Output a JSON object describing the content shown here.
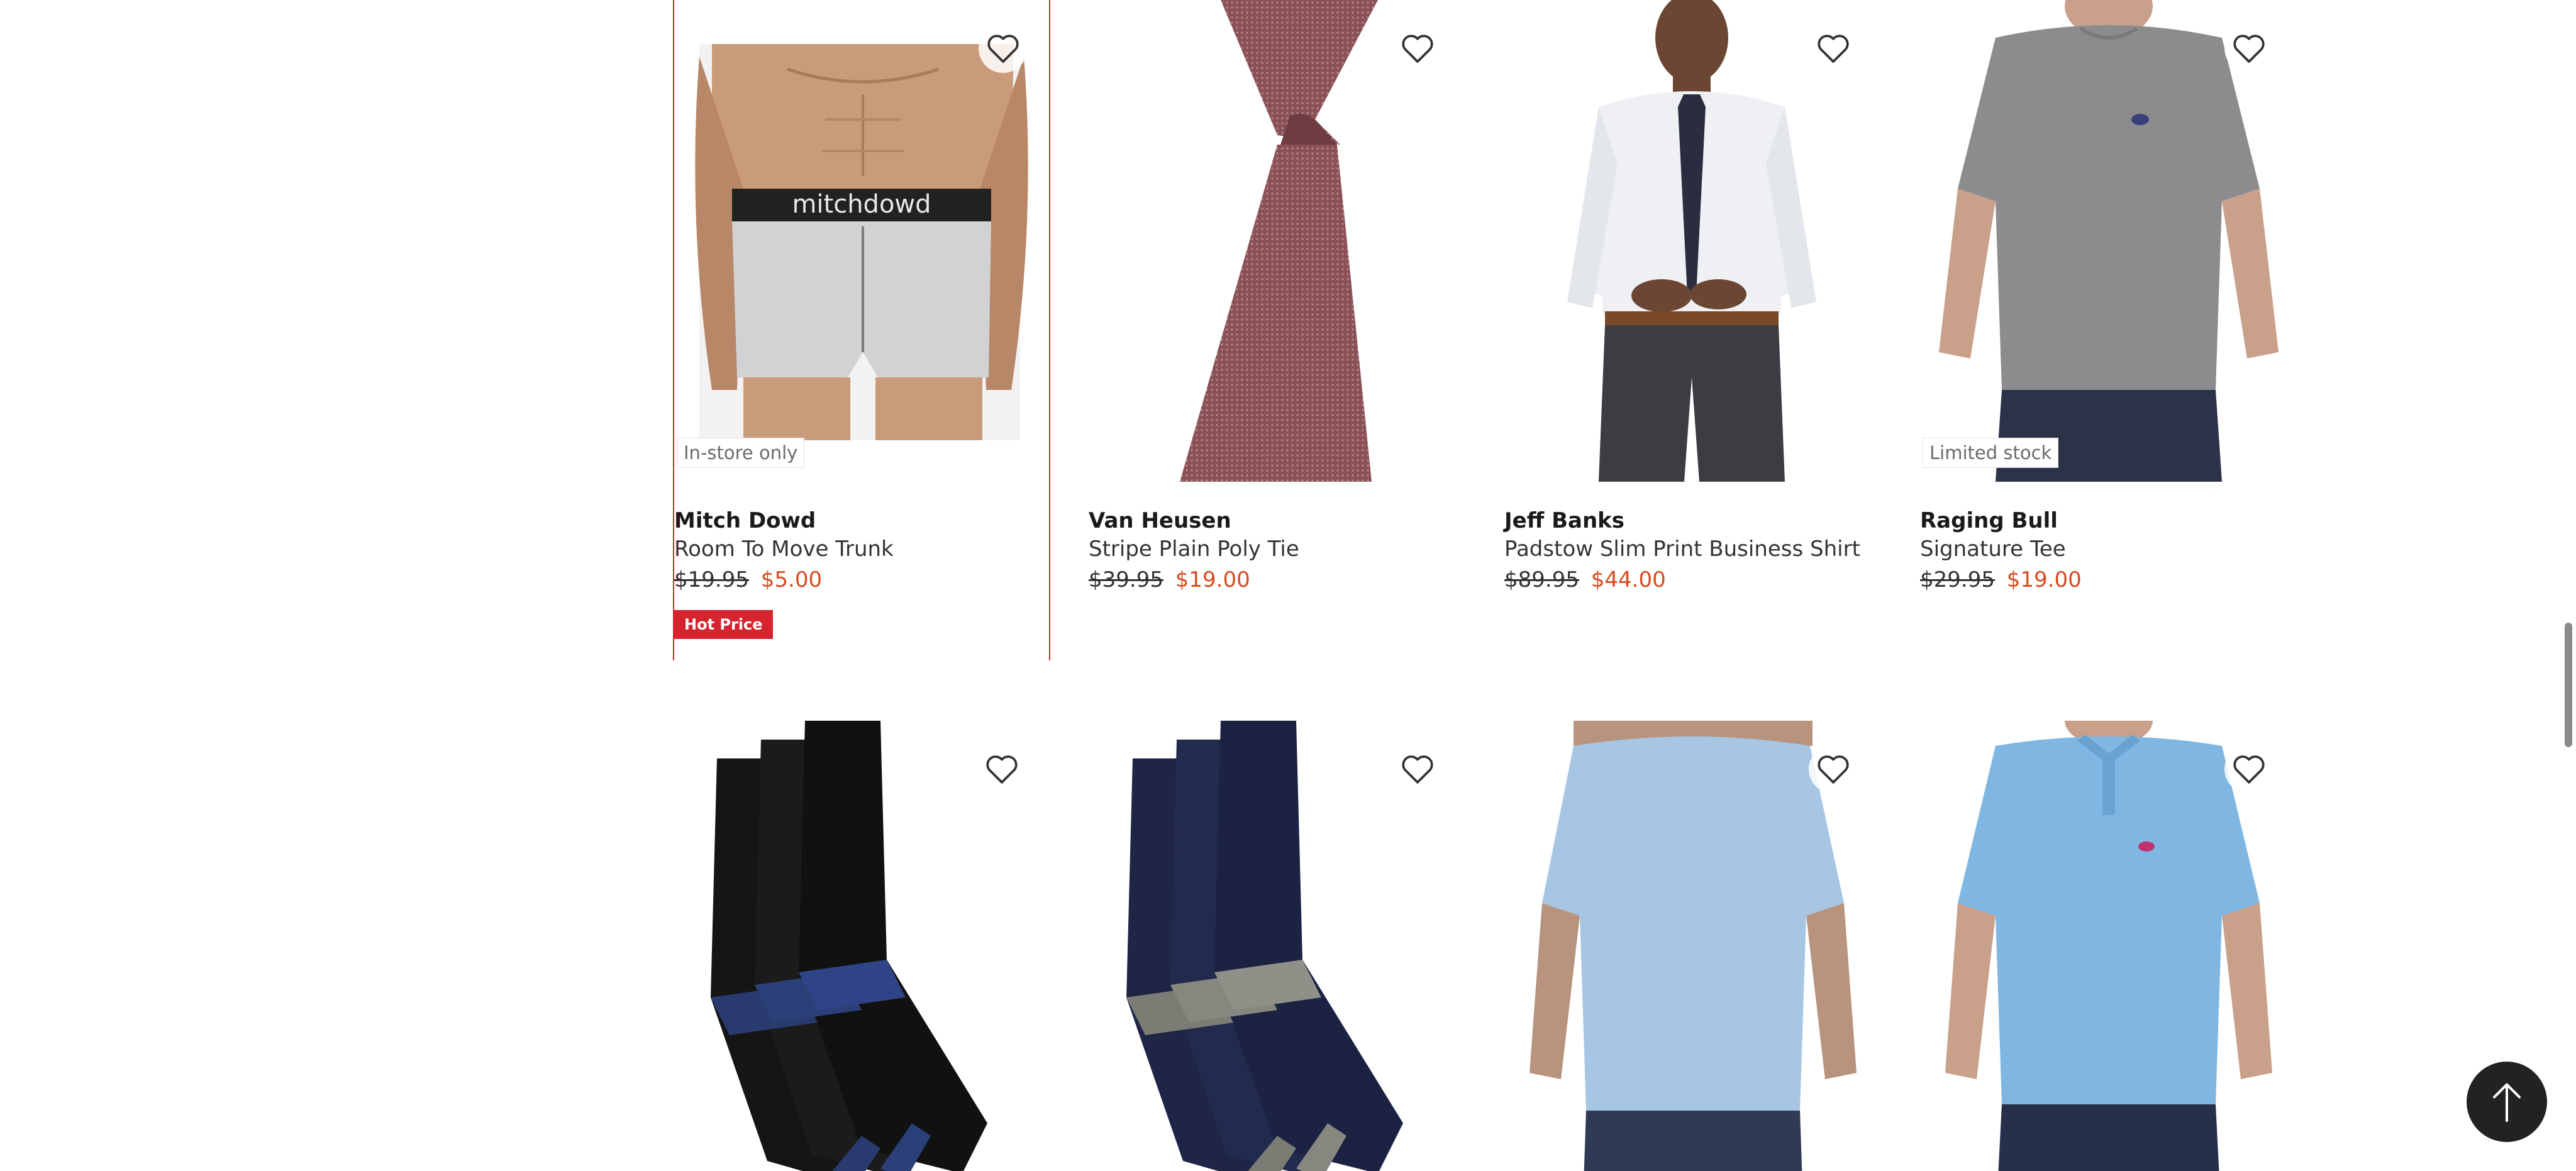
{
  "products": [
    {
      "brand": "Mitch Dowd",
      "name": "Room To Move Trunk",
      "was_price": "$19.95",
      "now_price": "$5.00",
      "badge": "In-store only",
      "tag": "Hot Price",
      "image_icon": "boxer-trunk-image",
      "waistband_text": "mitchdowd"
    },
    {
      "brand": "Van Heusen",
      "name": "Stripe Plain Poly Tie",
      "was_price": "$39.95",
      "now_price": "$19.00",
      "image_icon": "tie-image"
    },
    {
      "brand": "Jeff Banks",
      "name": "Padstow Slim Print Business Shirt",
      "was_price": "$89.95",
      "now_price": "$44.00",
      "image_icon": "business-shirt-image"
    },
    {
      "brand": "Raging Bull",
      "name": "Signature Tee",
      "was_price": "$29.95",
      "now_price": "$19.00",
      "badge": "Limited stock",
      "image_icon": "grey-tee-image"
    },
    {
      "image_icon": "black-socks-image"
    },
    {
      "image_icon": "navy-socks-image"
    },
    {
      "image_icon": "light-blue-tee-image"
    },
    {
      "image_icon": "blue-polo-image"
    }
  ],
  "icons": {
    "wishlist": "heart-icon",
    "back_to_top": "arrow-up-icon"
  },
  "colors": {
    "sale_price": "#d94a1f",
    "hot_price_tag": "#d6242f",
    "selected_outline": "#d6242f",
    "back_to_top": "#222222"
  }
}
